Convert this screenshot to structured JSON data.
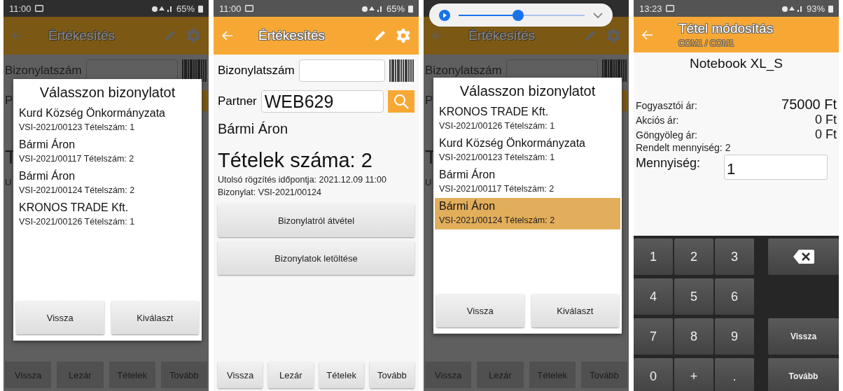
{
  "screens": [
    {
      "kind": "dialog",
      "status_bar": {
        "time": "11:00",
        "battery": "65%"
      },
      "app_bar": {
        "title": "Értékesítés"
      },
      "background": {
        "document_label": "Bizonylatszám",
        "partner_label": "P",
        "count_label": "T",
        "info_label": "U"
      },
      "dialog": {
        "title": "Válasszon bizonylatot",
        "items": [
          {
            "name": "Kurd Község Önkormányzata",
            "detail": "VSI-2021/00123 Tételszám: 1",
            "selected": false
          },
          {
            "name": "Bármi Áron",
            "detail": "VSI-2021/00117 Tételszám: 2",
            "selected": false
          },
          {
            "name": "Bármi Áron",
            "detail": "VSI-2021/00124 Tételszám: 2",
            "selected": false
          },
          {
            "name": "KRONOS TRADE Kft.",
            "detail": "VSI-2021/00126 Tételszám: 1",
            "selected": false
          }
        ],
        "buttons": [
          "Vissza",
          "Kiválaszt"
        ]
      },
      "bottom_buttons": [
        "Vissza",
        "Lezár",
        "Tételek",
        "Tovább"
      ]
    },
    {
      "kind": "form",
      "status_bar": {
        "time": "11:00",
        "battery": "65%"
      },
      "app_bar": {
        "title": "Értékesítés"
      },
      "document_label": "Bizonylatszám",
      "partner_label": "Partner",
      "partner_value": "WEB629",
      "partner_name": "Bármi Áron",
      "count": "Tételek száma: 2",
      "last_saved": "Utolsó rögzítés időpontja: 2021.12.09 11:00",
      "document": "Bizonylat: VSI-2021/00124",
      "actions": [
        "Bizonylatról átvétel",
        "Bizonylatok letöltése"
      ],
      "bottom_buttons": [
        "Vissza",
        "Lezár",
        "Tételek",
        "Tovább"
      ]
    },
    {
      "kind": "dialog",
      "media_player": {
        "level": 0.47
      },
      "app_bar": {
        "title": "Értékesítés"
      },
      "background": {
        "document_label": "Bizonylatszám",
        "partner_label": "P",
        "count_label": "T",
        "info_label": "U"
      },
      "dialog": {
        "title": "Válasszon bizonylatot",
        "items": [
          {
            "name": "KRONOS TRADE Kft.",
            "detail": "VSI-2021/00126 Tételszám: 1",
            "selected": false
          },
          {
            "name": "Kurd Község Önkormányzata",
            "detail": "VSI-2021/00123 Tételszám: 1",
            "selected": false
          },
          {
            "name": "Bármi Áron",
            "detail": "VSI-2021/00117 Tételszám: 2",
            "selected": false
          },
          {
            "name": "Bármi Áron",
            "detail": "VSI-2021/00124 Tételszám: 2",
            "selected": true
          }
        ],
        "buttons": [
          "Vissza",
          "Kiválaszt"
        ]
      },
      "bottom_buttons": [
        "Vissza",
        "Lezár",
        "Tételek",
        "Tovább"
      ]
    },
    {
      "kind": "keypad",
      "status_bar": {
        "time": "13:23",
        "battery": "93%"
      },
      "app_bar": {
        "title": "Tétel módosítás",
        "subtitle": "COM1 / COM1"
      },
      "product": "Notebook XL_S",
      "prices": [
        {
          "label": "Fogyasztói ár:",
          "value": "75000 Ft"
        },
        {
          "label": "Akciós ár:",
          "value": "0 Ft"
        },
        {
          "label": "Göngyöleg ár:",
          "value": "0 Ft"
        }
      ],
      "ordered": "Rendelt mennyiség: 2",
      "quantity_label": "Mennyiség:",
      "quantity_value": "1",
      "keys": [
        {
          "kind": "digit",
          "label": "1"
        },
        {
          "kind": "digit",
          "label": "2"
        },
        {
          "kind": "digit",
          "label": "3"
        },
        {
          "kind": "backspace"
        },
        {
          "kind": "digit",
          "label": "4"
        },
        {
          "kind": "digit",
          "label": "5"
        },
        {
          "kind": "digit",
          "label": "6"
        },
        {
          "kind": "blank"
        },
        {
          "kind": "digit",
          "label": "7"
        },
        {
          "kind": "digit",
          "label": "8"
        },
        {
          "kind": "digit",
          "label": "9"
        },
        {
          "kind": "action",
          "label": "Vissza"
        },
        {
          "kind": "digit",
          "label": "0"
        },
        {
          "kind": "digit",
          "label": "+"
        },
        {
          "kind": "digit",
          "label": "."
        },
        {
          "kind": "action",
          "label": "Tovább"
        }
      ]
    }
  ]
}
